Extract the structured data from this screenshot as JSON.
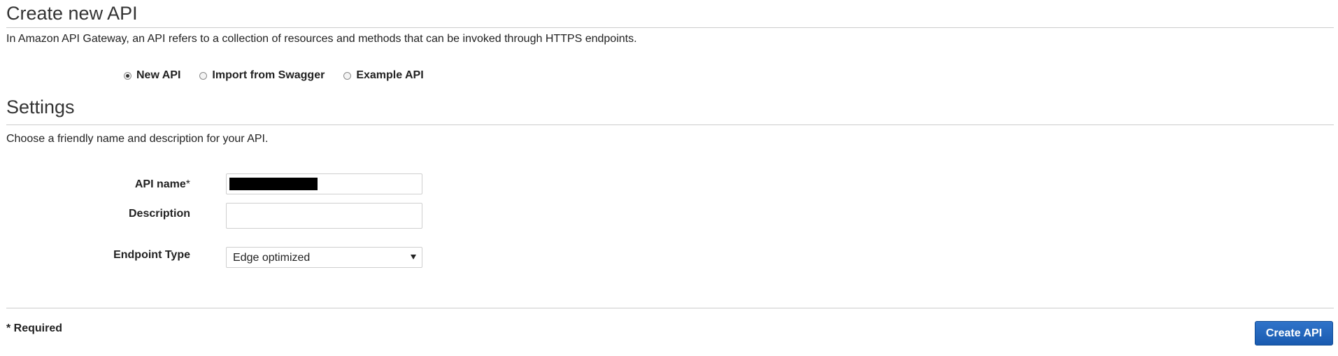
{
  "create_section": {
    "title": "Create new API",
    "intro": "In Amazon API Gateway, an API refers to a collection of resources and methods that can be invoked through HTTPS endpoints.",
    "options": [
      {
        "label": "New API",
        "selected": true
      },
      {
        "label": "Import from Swagger",
        "selected": false
      },
      {
        "label": "Example API",
        "selected": false
      }
    ]
  },
  "settings": {
    "title": "Settings",
    "intro": "Choose a friendly name and description for your API.",
    "api_name_label": "API name",
    "api_name_required_mark": "*",
    "description_label": "Description",
    "description_value": "",
    "endpoint_type_label": "Endpoint Type",
    "endpoint_type_value": "Edge optimized"
  },
  "footer": {
    "required_note": "* Required",
    "create_button_label": "Create API"
  },
  "colors": {
    "accent": "#1a5bb0",
    "rule": "#cccccc",
    "text": "#222222"
  },
  "icons": {
    "select_caret": "caret-down-icon",
    "radio": "radio-icon"
  }
}
